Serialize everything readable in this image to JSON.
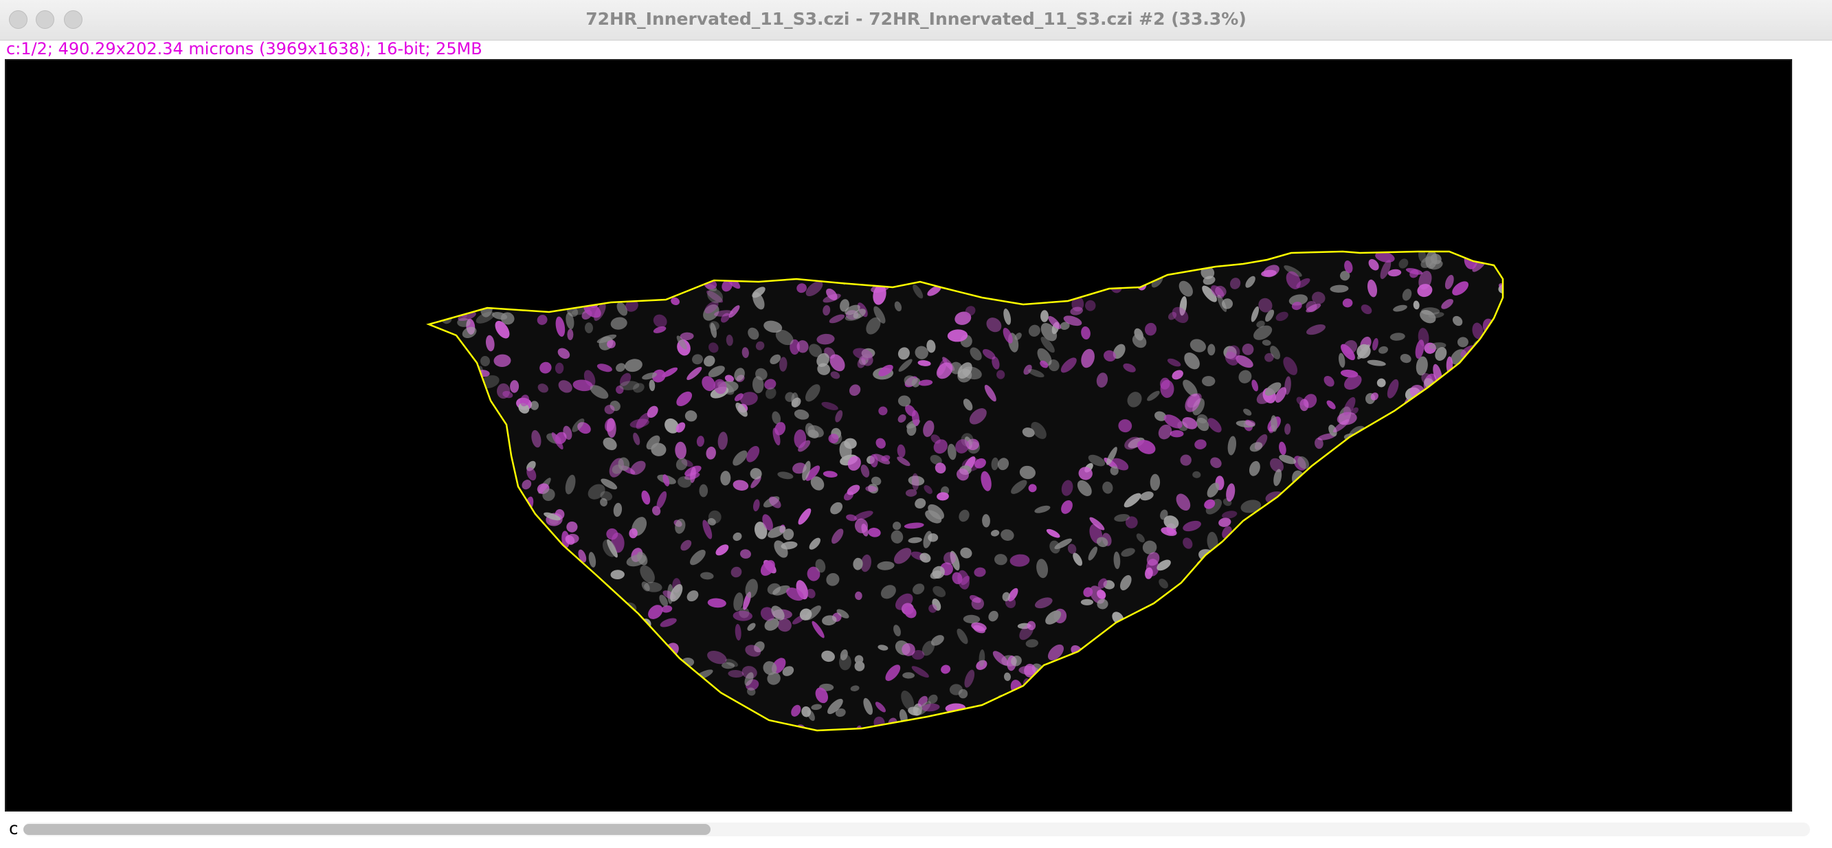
{
  "window": {
    "title": "72HR_Innervated_11_S3.czi - 72HR_Innervated_11_S3.czi #2 (33.3%)",
    "buttons": [
      "close",
      "minimize",
      "zoom"
    ]
  },
  "image_info": {
    "text": "c:1/2; 490.29x202.34 microns (3969x1638); 16-bit; 25MB"
  },
  "canvas": {
    "description_icon": "fluorescence-tissue-section",
    "roi_color": "#ffff00",
    "nucleus_colors": [
      "#b040b8",
      "#d060d6",
      "#8a8a8a",
      "#a9a9a9"
    ]
  },
  "bottom": {
    "channel_slider_label": "c",
    "scroll_position_fraction": 0.5
  }
}
